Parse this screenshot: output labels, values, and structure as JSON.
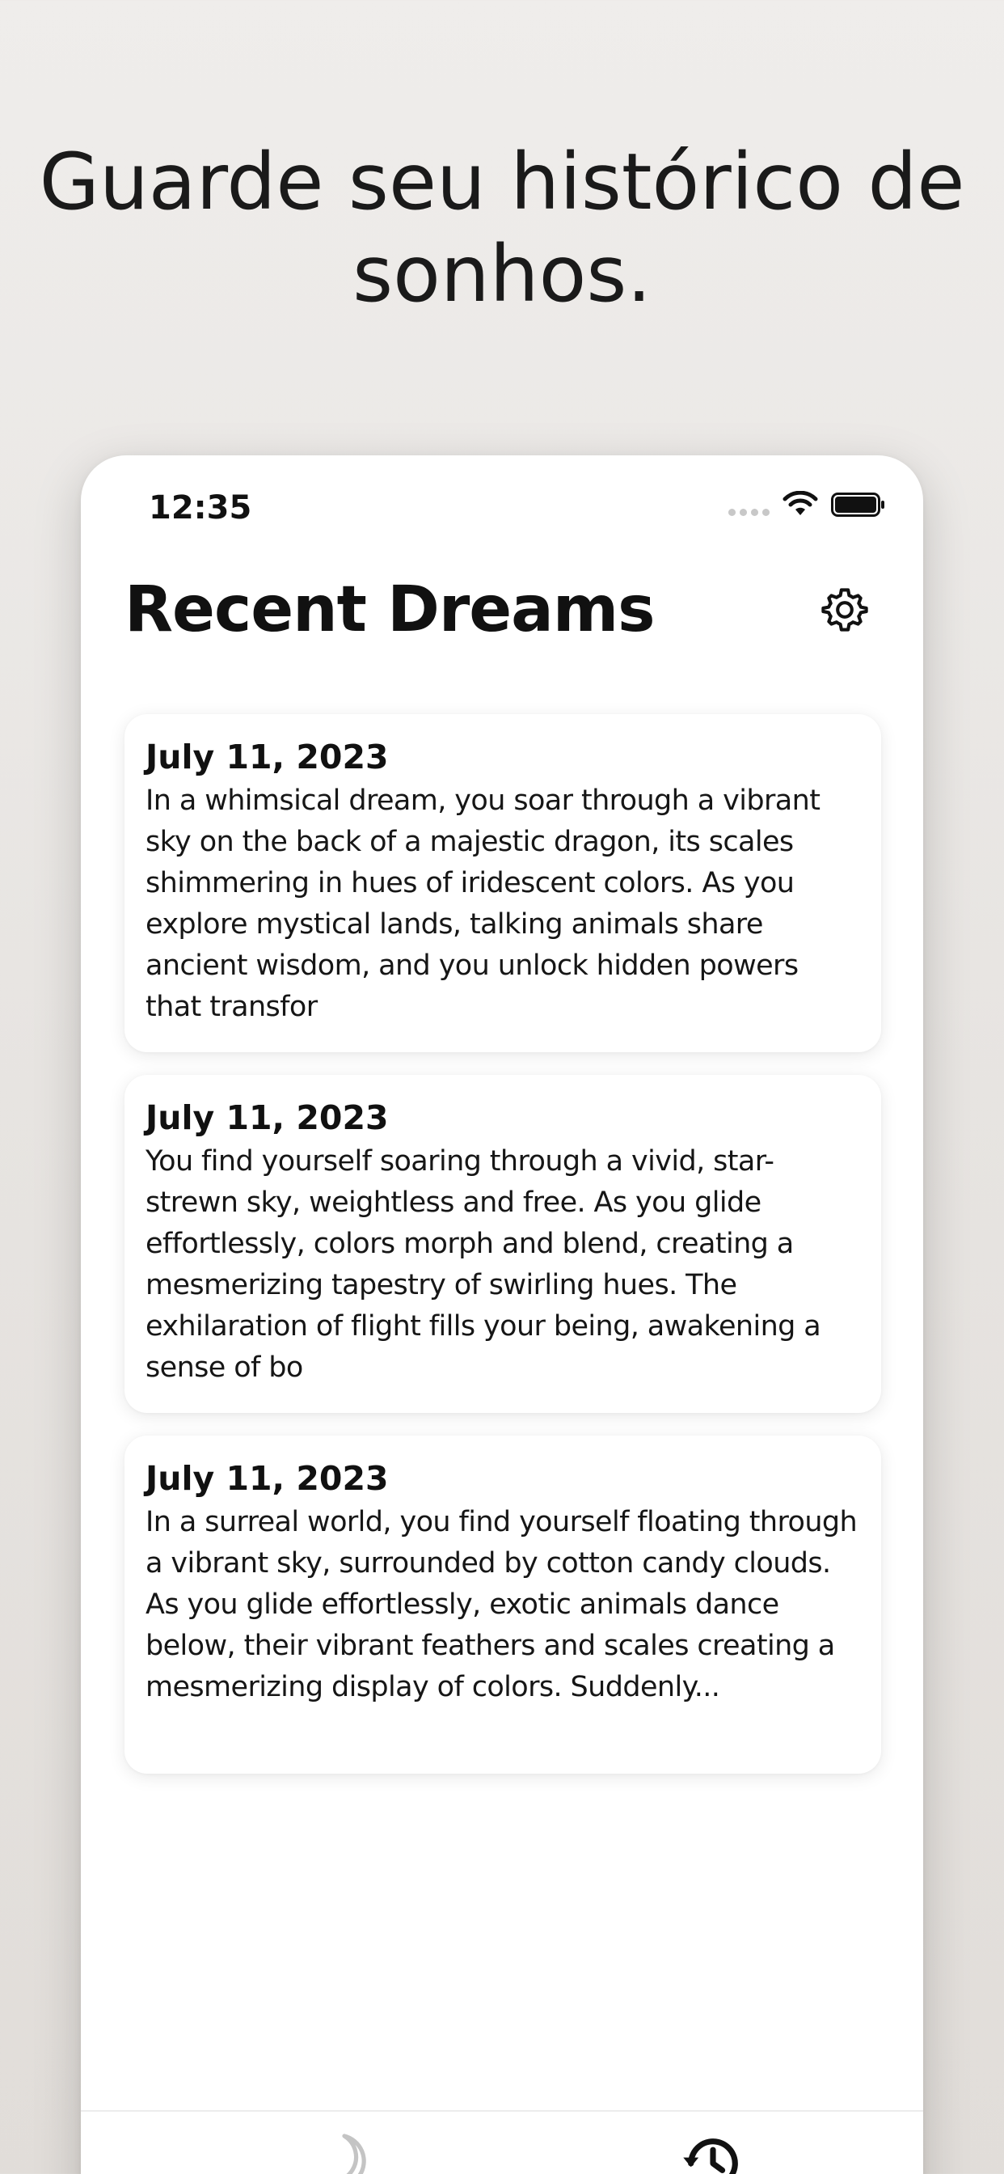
{
  "headline": {
    "line1": "Guarde seu histórico de",
    "line2": "sonhos."
  },
  "status_bar": {
    "time": "12:35",
    "icons": [
      "signal-dots-icon",
      "wifi-icon",
      "battery-icon"
    ]
  },
  "header": {
    "title": "Recent Dreams",
    "settings_icon": "gear-icon"
  },
  "dreams": [
    {
      "date": "July 11, 2023",
      "text": "In a whimsical dream, you soar through a vibrant sky on the back of a majestic dragon, its scales shimmering in hues of iridescent colors. As you explore mystical lands, talking animals share ancient wisdom, and you unlock hidden powers that transfor"
    },
    {
      "date": "July 11, 2023",
      "text": "You find yourself soaring through a vivid, star-strewn sky, weightless and free. As you glide effortlessly, colors morph and blend, creating a mesmerizing tapestry of swirling hues. The exhilaration of flight fills your being, awakening a sense of bo"
    },
    {
      "date": "July 11, 2023",
      "text": "In a surreal world, you find yourself floating through a vibrant sky, surrounded by cotton candy clouds. As you glide effortlessly, exotic animals dance below, their vibrant feathers and scales creating a mesmerizing display of colors. Suddenly..."
    }
  ],
  "tab_bar": {
    "tabs": [
      {
        "icon": "moon-icon",
        "active": false
      },
      {
        "icon": "history-clock-icon",
        "active": true
      }
    ]
  },
  "colors": {
    "background": "#e7e4e1",
    "text": "#111111",
    "inactive_tab": "#c4c4c4",
    "card": "#ffffff"
  }
}
